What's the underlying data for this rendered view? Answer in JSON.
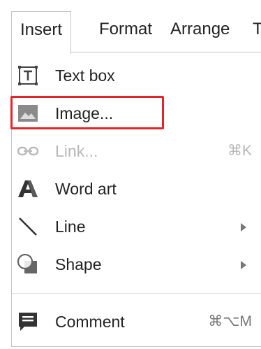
{
  "menubar": {
    "tabs": [
      {
        "label": "Insert"
      },
      {
        "label": "Format"
      },
      {
        "label": "Arrange"
      },
      {
        "label": "T"
      }
    ]
  },
  "menu": {
    "items": [
      {
        "label": "Text box",
        "icon": "text-box-icon",
        "enabled": true
      },
      {
        "label": "Image...",
        "icon": "image-icon",
        "enabled": true,
        "highlighted": true
      },
      {
        "label": "Link...",
        "icon": "link-icon",
        "enabled": false,
        "shortcut": "⌘K"
      },
      {
        "label": "Word art",
        "icon": "word-art-icon",
        "enabled": true
      },
      {
        "label": "Line",
        "icon": "line-icon",
        "enabled": true,
        "submenu": true
      },
      {
        "label": "Shape",
        "icon": "shape-icon",
        "enabled": true,
        "submenu": true
      },
      {
        "label": "Comment",
        "icon": "comment-icon",
        "enabled": true,
        "shortcut": "⌘⌥M"
      }
    ]
  },
  "colors": {
    "highlight_border": "#e0272b",
    "menu_border": "#c6c6c6",
    "text": "#222222",
    "disabled_text": "#b8b8b8"
  }
}
